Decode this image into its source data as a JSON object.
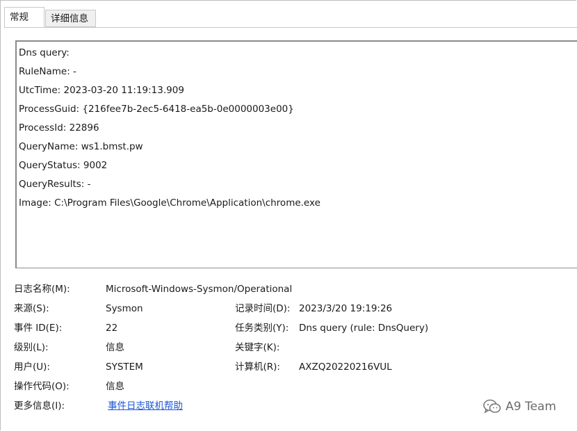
{
  "tabs": [
    {
      "label": "常规"
    },
    {
      "label": "详细信息"
    }
  ],
  "detail_lines": [
    "Dns query:",
    "RuleName: -",
    "UtcTime: 2023-03-20 11:19:13.909",
    "ProcessGuid: {216fee7b-2ec5-6418-ea5b-0e0000003e00}",
    "ProcessId: 22896",
    "QueryName: ws1.bmst.pw",
    "QueryStatus: 9002",
    "QueryResults: -",
    "Image: C:\\Program Files\\Google\\Chrome\\Application\\chrome.exe"
  ],
  "props": {
    "log_name_label": "日志名称(M):",
    "log_name_value": "Microsoft-Windows-Sysmon/Operational",
    "source_label": "来源(S):",
    "source_value": "Sysmon",
    "logged_label": "记录时间(D):",
    "logged_value": "2023/3/20 19:19:26",
    "event_id_label": "事件 ID(E):",
    "event_id_value": "22",
    "task_label": "任务类别(Y):",
    "task_value": "Dns query (rule: DnsQuery)",
    "level_label": "级别(L):",
    "level_value": "信息",
    "keywords_label": "关键字(K):",
    "keywords_value": "",
    "user_label": "用户(U):",
    "user_value": "SYSTEM",
    "computer_label": "计算机(R):",
    "computer_value": "AXZQ20220216VUL",
    "opcode_label": "操作代码(O):",
    "opcode_value": "信息",
    "more_info_label": "更多信息(I):",
    "more_info_link": "事件日志联机帮助"
  },
  "watermark": {
    "text": "A9 Team",
    "icon": "wechat-icon"
  }
}
